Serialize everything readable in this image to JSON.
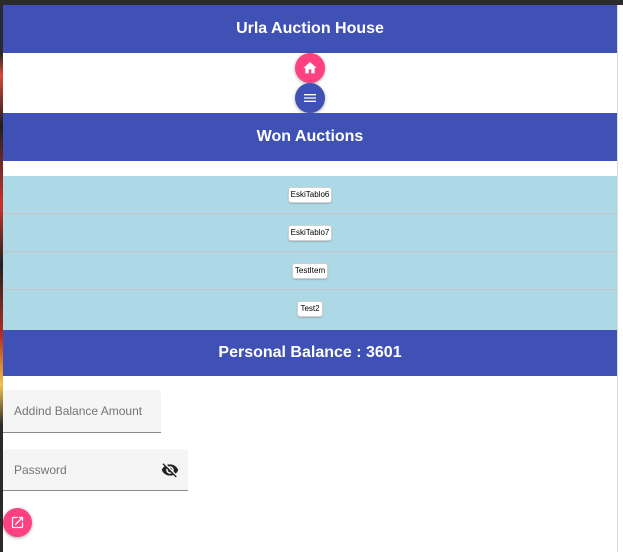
{
  "header": {
    "title": "Urla Auction House"
  },
  "nav": {
    "home_icon": "home-icon",
    "menu_icon": "menu-icon"
  },
  "won_auctions": {
    "title": "Won Auctions",
    "items": [
      "EskiTablo6",
      "EskiTablo7",
      "TestItem",
      "Test2"
    ]
  },
  "balance": {
    "label": "Personal Balance : 3601"
  },
  "form": {
    "amount_placeholder": "Addind Balance Amount",
    "amount_value": "",
    "password_placeholder": "Password",
    "password_value": "",
    "visibility_icon": "visibility-off-icon"
  },
  "actions": {
    "edit_icon": "open-in-new-icon"
  },
  "colors": {
    "primary": "#3f51b5",
    "accent": "#ff4081",
    "list_bg": "#add8e6"
  }
}
